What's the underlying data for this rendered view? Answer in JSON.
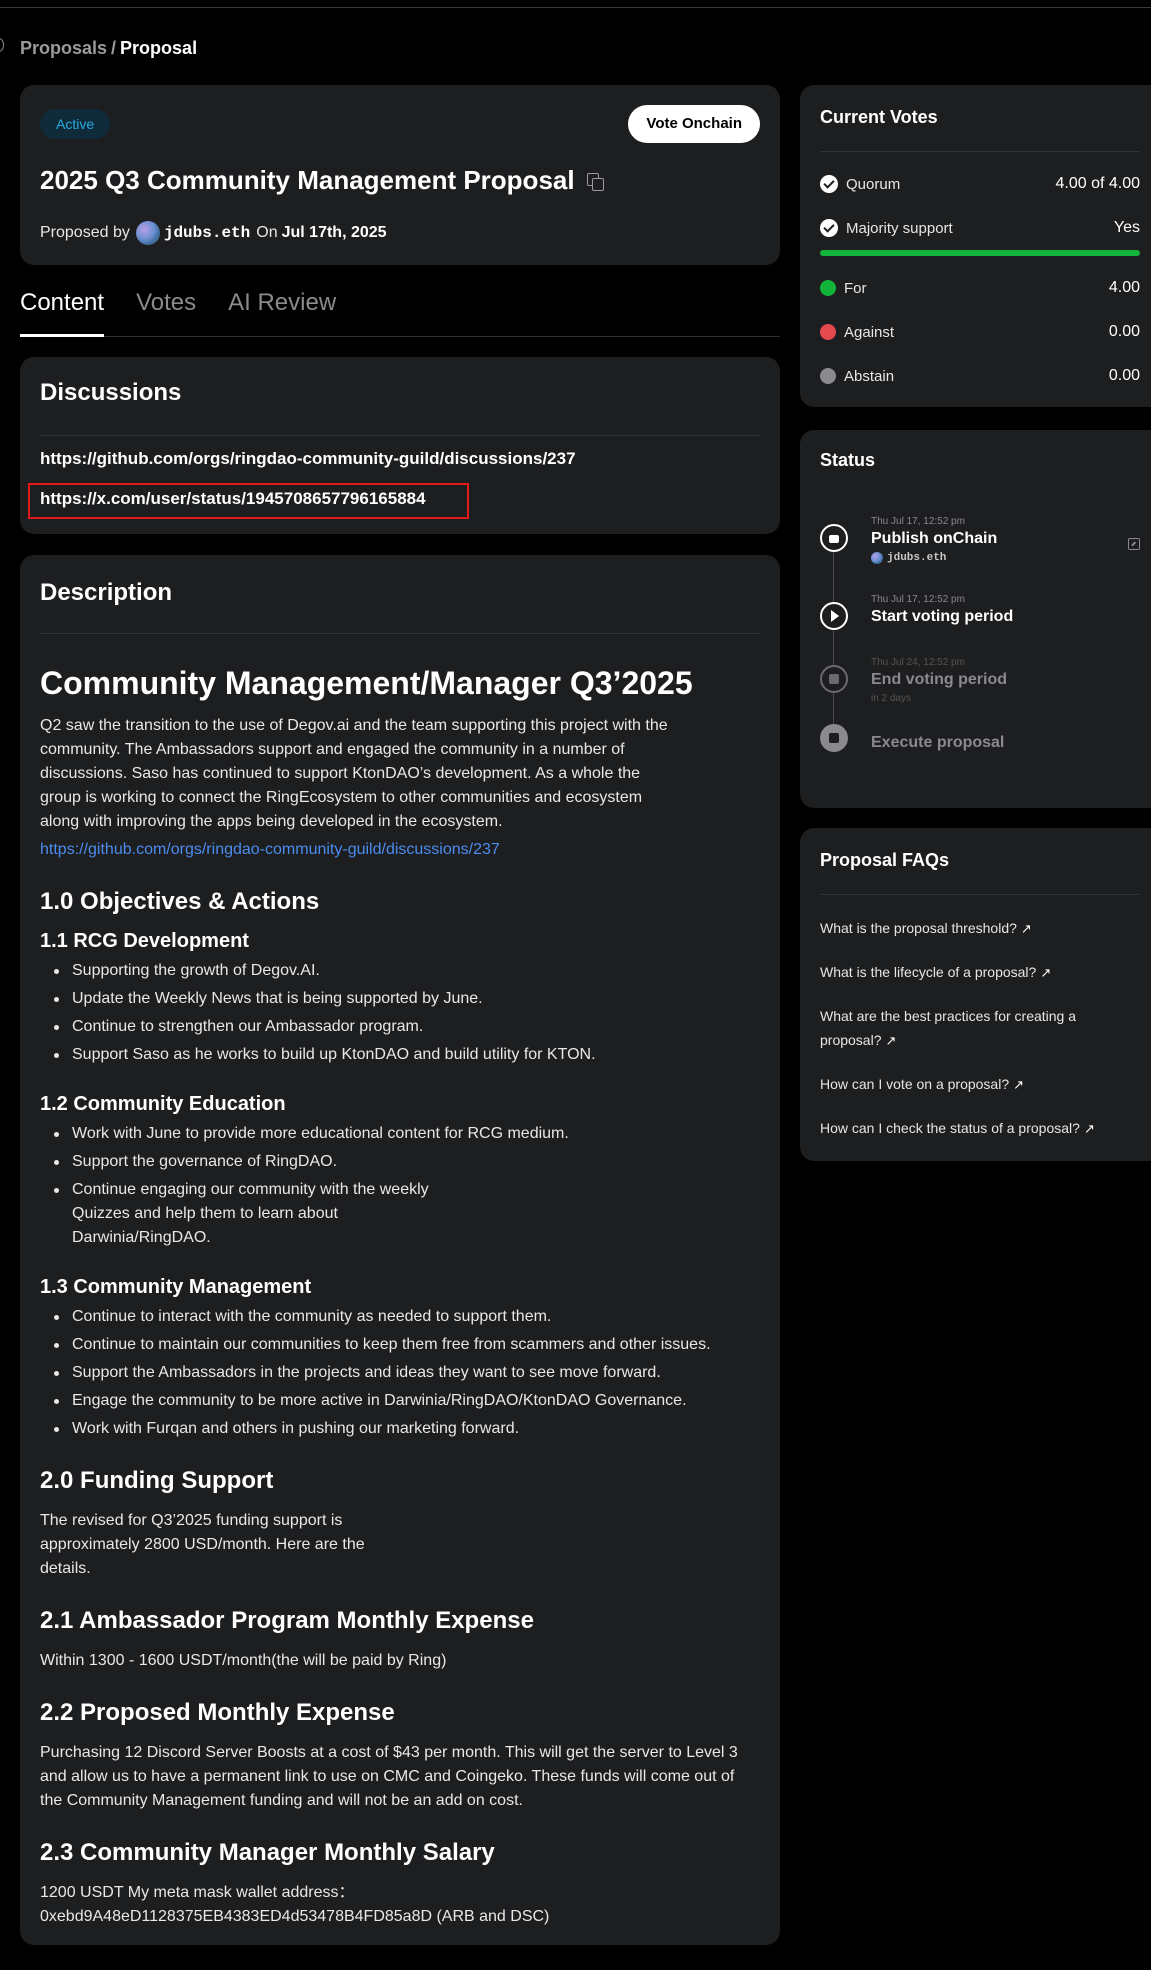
{
  "breadcrumb": {
    "parent": "Proposals",
    "separator": "/",
    "current": "Proposal"
  },
  "proposal": {
    "status_badge": "Active",
    "vote_button": "Vote Onchain",
    "title": "2025 Q3 Community Management Proposal",
    "proposed_by_label": "Proposed by",
    "author": "jdubs.eth",
    "on_label": "On",
    "date": "Jul 17th, 2025"
  },
  "tabs": [
    {
      "label": "Content",
      "active": true
    },
    {
      "label": "Votes",
      "active": false
    },
    {
      "label": "AI Review",
      "active": false
    }
  ],
  "discussions": {
    "title": "Discussions",
    "links": [
      "https://github.com/orgs/ringdao-community-guild/discussions/237",
      "https://x.com/user/status/1945708657796165884"
    ]
  },
  "description": {
    "title": "Description",
    "heading": "Community Management/Manager Q3’2025",
    "intro": "Q2 saw the transition to the use of Degov.ai and the team supporting this project with the community. The Ambassadors support and engaged the community in a number of discussions. Saso has continued to support KtonDAO’s development. As a whole the group is working to connect the RingEcosystem to other communities and ecosystem along with improving the apps being developed in the ecosystem.",
    "intro_link": "https://github.com/orgs/ringdao-community-guild/discussions/237",
    "objectives_heading": "1.0 Objectives & Actions",
    "s11": {
      "heading": "1.1 RCG Development",
      "items": [
        "Supporting the growth of Degov.AI.",
        "Update the Weekly News that is being supported by June.",
        "Continue to strengthen our Ambassador program.",
        "Support Saso as he works to build up KtonDAO and build utility for KTON."
      ]
    },
    "s12": {
      "heading": "1.2 Community Education",
      "items": [
        "Work with June to provide more educational content for RCG medium.",
        "Support the governance of RingDAO.",
        "Continue engaging our community with the weekly Quizzes and help them to learn about Darwinia/RingDAO."
      ]
    },
    "s13": {
      "heading": "1.3 Community Management",
      "items": [
        "Continue to interact with the community as needed to support them.",
        "Continue to maintain our communities to keep them free from scammers and other issues.",
        "Support the Ambassadors in the projects and ideas they want to see move forward.",
        "Engage the community to be more active in Darwinia/RingDAO/KtonDAO Governance.",
        "Work with Furqan and others in pushing our marketing forward."
      ]
    },
    "funding_heading": "2.0 Funding Support",
    "funding_text": "The revised for Q3’2025 funding support is approximately 2800 USD/month. Here are the details.",
    "s21_heading": "2.1 Ambassador Program Monthly Expense",
    "s21_text": "Within 1300 - 1600 USDT/month(the will be paid by Ring)",
    "s22_heading": "2.2 Proposed Monthly Expense",
    "s22_text": "Purchasing 12 Discord Server Boosts at a cost of $43 per month. This will get the server to Level 3 and allow us to have a permanent link to use on CMC and Coingeko. These funds will come out of the Community Management funding and will not be an add on cost.",
    "s23_heading": "2.3 Community Manager Monthly Salary",
    "s23_line1": "1200 USDT My meta mask wallet address：",
    "s23_line2": "0xebd9A48eD1128375EB4383ED4d53478B4FD85a8D (ARB and DSC)"
  },
  "current_votes": {
    "title": "Current Votes",
    "quorum_label": "Quorum",
    "quorum_value": "4.00 of 4.00",
    "majority_label": "Majority support",
    "majority_value": "Yes",
    "support_fraction": 1.0,
    "for_label": "For",
    "for_value": "4.00",
    "against_label": "Against",
    "against_value": "0.00",
    "abstain_label": "Abstain",
    "abstain_value": "0.00",
    "colors": {
      "for": "#12b33a",
      "against": "#e5484d",
      "abstain": "#8a8a8e"
    }
  },
  "status": {
    "title": "Status",
    "steps": [
      {
        "time": "Thu Jul 17, 12:52 pm",
        "name": "Publish onChain",
        "sub": "jdubs.eth"
      },
      {
        "time": "Thu Jul 17, 12:52 pm",
        "name": "Start voting period"
      },
      {
        "time": "Thu Jul 24, 12:52 pm",
        "name": "End voting period",
        "sub": "in 2 days"
      },
      {
        "name": "Execute proposal"
      }
    ]
  },
  "faq": {
    "title": "Proposal FAQs",
    "items": [
      "What is the proposal threshold?",
      "What is the lifecycle of a proposal?",
      "What are the best practices for creating a proposal?",
      "How can I vote on a proposal?",
      "How can I check the status of a proposal?"
    ]
  }
}
